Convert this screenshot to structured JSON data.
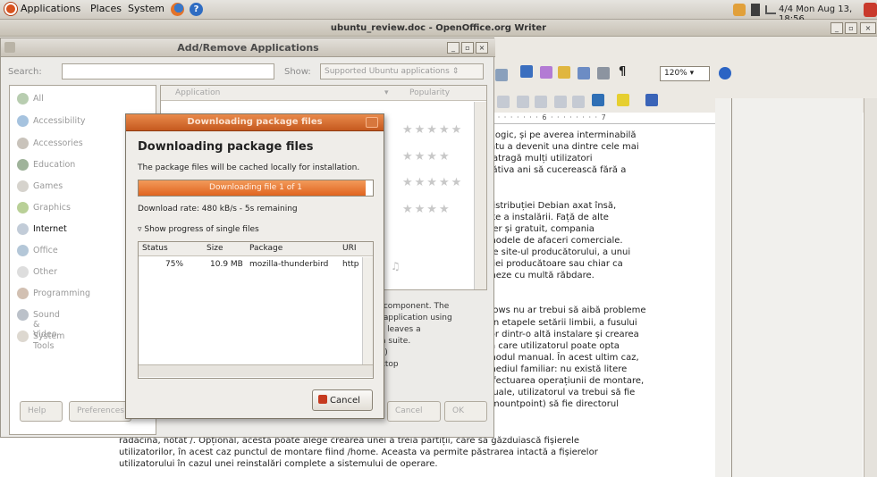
{
  "top_panel": {
    "menus": [
      "Applications",
      "Places",
      "System"
    ],
    "clock": "Mon Aug 13, 18:56",
    "workspace": "4/4"
  },
  "writer": {
    "title": "ubuntu_review.doc - OpenOffice.org Writer",
    "zoom": "120%",
    "ruler": "· 5 · · · · · · · 6 · · · · · · · · 7",
    "right_lines": [
      "ologic, și pe averea interminabilă",
      "intu a devenit una dintre cele mai",
      "i atragă mulți utilizatori",
      "cătiva ani să cucerească fără a",
      "",
      "",
      " distribuției Debian axat însă,",
      "ste a instalării. Față de alte",
      "ber și gratuit, compania",
      " modele de afaceri comerciale.",
      " pe site-ul producătorului, a unui",
      "niei producătoare sau chiar ca",
      "meze cu multă răbdare.",
      "",
      "",
      "dows nu ar trebui să aibă probleme",
      "rin etapele setării limbii, a fusului",
      "lor dintr-o altă instalare și crearea",
      " în care utilizatorul poate opta",
      "modul manual. În acest ultim caz,",
      "mediul familiar: nu există litere",
      "efectuarea operațiunii de montare,",
      "nuale, utilizatorul va trebui să fie",
      " (mountpoint) să fie directorul"
    ],
    "bottom_lines": [
      "rădăcină, notat /. Opțional, acesta poate alege crearea unei a treia partiții, care să găzduiască fișierele",
      "utilizatorilor, în acest caz punctul de montare fiind /home. Aceasta va permite păstrarea intactă a fișierelor",
      "utilizatorului în cazul unei reinstalări complete a sistemului de operare."
    ]
  },
  "add_remove": {
    "title": "Add/Remove Applications",
    "search_label": "Search:",
    "show_label": "Show:",
    "show_value": "Supported Ubuntu applications",
    "categories": [
      "All",
      "Accessibility",
      "Accessories",
      "Education",
      "Games",
      "Graphics",
      "Internet",
      "Office",
      "Other",
      "Programming",
      "Sound & Video",
      "System Tools"
    ],
    "selected_category": "Internet",
    "column_application": "Application",
    "column_popularity": "Popularity",
    "description_lines": [
      "il component. The",
      "il application using",
      "rd leaves a",
      "lla suite.",
      "rd)",
      "sktop"
    ],
    "buttons": {
      "help": "Help",
      "preferences": "Preferences",
      "cancel": "Cancel",
      "ok": "OK"
    }
  },
  "download": {
    "title": "Downloading package files",
    "heading": "Downloading package files",
    "info": "The package files will be cached locally for installation.",
    "progress_text": "Downloading file 1 of 1",
    "progress_fraction": 0.97,
    "rate": "Download rate: 480 kB/s - 5s remaining",
    "show_progress": "Show progress of single files",
    "columns": [
      "Status",
      "Size",
      "Package",
      "URI"
    ],
    "rows": [
      {
        "status": "75%",
        "size": "10.9 MB",
        "package": "mozilla-thunderbird",
        "uri": "http"
      }
    ],
    "cancel": "Cancel"
  }
}
